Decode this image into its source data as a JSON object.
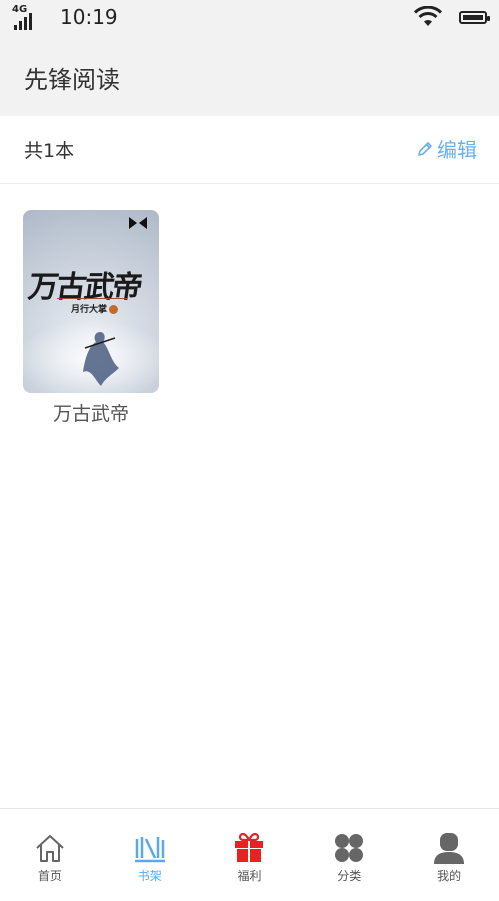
{
  "status_bar": {
    "network": "4G",
    "time": "10:19"
  },
  "header": {
    "title": "先锋阅读"
  },
  "toolbar": {
    "count_text": "共1本",
    "edit_label": "编辑"
  },
  "books": [
    {
      "name": "万古武帝",
      "cover_title": "万古武帝",
      "cover_author": "月行大掌"
    }
  ],
  "tabs": [
    {
      "label": "首页",
      "icon": "home-icon",
      "active": false
    },
    {
      "label": "书架",
      "icon": "bookshelf-icon",
      "active": true
    },
    {
      "label": "福利",
      "icon": "gift-icon",
      "active": false
    },
    {
      "label": "分类",
      "icon": "category-icon",
      "active": false
    },
    {
      "label": "我的",
      "icon": "user-icon",
      "active": false
    }
  ],
  "colors": {
    "accent": "#5aa9ec",
    "gift": "#e62222",
    "header_bg": "#f2f2f2"
  }
}
